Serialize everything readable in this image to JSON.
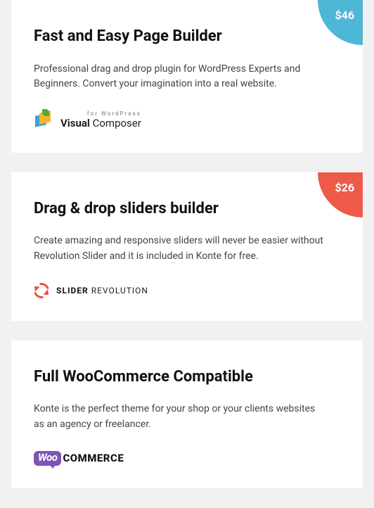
{
  "cards": [
    {
      "title": "Fast and Easy Page Builder",
      "desc": "Professional drag and drop plugin for WordPress Experts and Beginners. Convert your imagination into a real website.",
      "price": "$46",
      "logo": {
        "top": "for WordPress",
        "left": "Visual ",
        "right": "Composer"
      }
    },
    {
      "title": "Drag & drop sliders builder",
      "desc": "Create amazing and responsive sliders will never be easier without Revolution Slider and it is included in Konte for free.",
      "price": "$26",
      "logo": {
        "left": "SLIDER ",
        "right": "REVOLUTION"
      }
    },
    {
      "title": "Full WooCommerce Compatible",
      "desc": "Konte is the perfect theme for your shop or your clients websites as an agency or freelancer.",
      "logo": {
        "left": "Woo",
        "right": "COMMERCE"
      }
    }
  ]
}
